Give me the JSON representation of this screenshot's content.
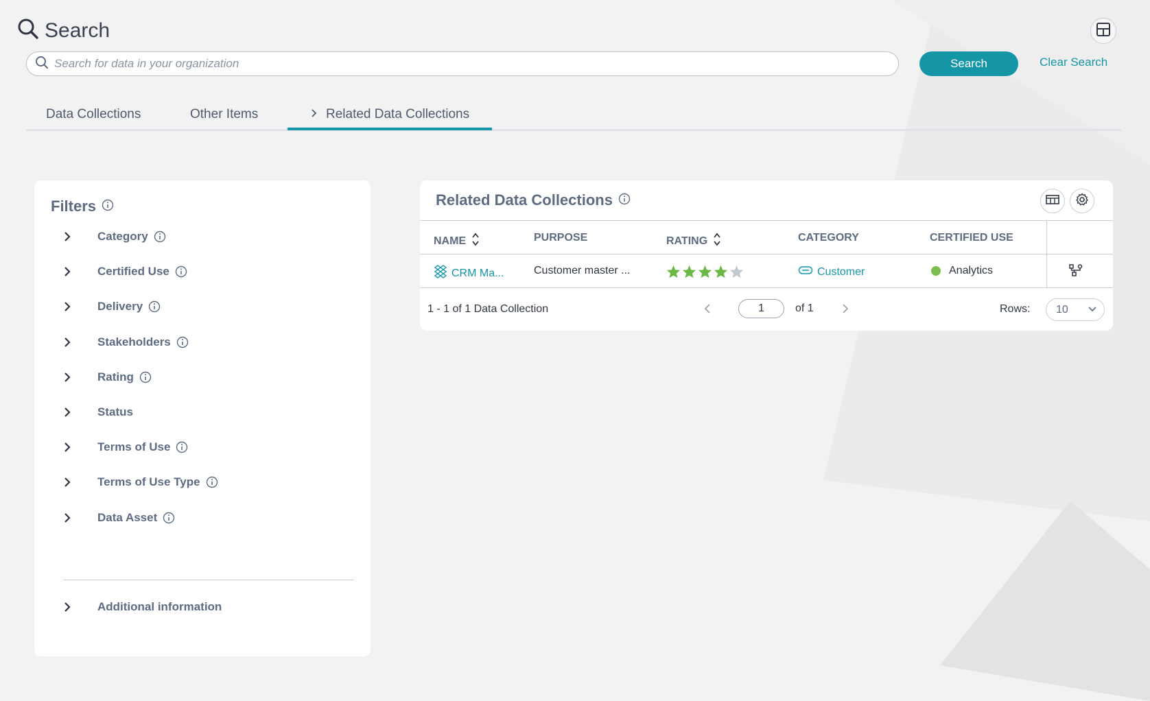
{
  "header": {
    "title": "Search",
    "icon": "search-icon"
  },
  "search": {
    "placeholder": "Search for data in your organization",
    "value": "",
    "button_label": "Search",
    "clear_label": "Clear Search"
  },
  "tabs": [
    {
      "label": "Data Collections",
      "active": false
    },
    {
      "label": "Other Items",
      "active": false
    },
    {
      "label": "Related Data Collections",
      "active": true
    }
  ],
  "filters": {
    "title": "Filters",
    "items": [
      {
        "label": "Category",
        "has_info": true
      },
      {
        "label": "Certified Use",
        "has_info": true
      },
      {
        "label": "Delivery",
        "has_info": true
      },
      {
        "label": "Stakeholders",
        "has_info": true
      },
      {
        "label": "Rating",
        "has_info": true
      },
      {
        "label": "Status",
        "has_info": false
      },
      {
        "label": "Terms of Use",
        "has_info": true
      },
      {
        "label": "Terms of Use Type",
        "has_info": true
      },
      {
        "label": "Data Asset",
        "has_info": true
      }
    ],
    "additional": "Additional information"
  },
  "results": {
    "title": "Related Data Collections",
    "columns": [
      "NAME",
      "PURPOSE",
      "RATING",
      "CATEGORY",
      "CERTIFIED USE"
    ],
    "rows": [
      {
        "name": "CRM Ma...",
        "purpose": "Customer master ...",
        "rating": 4,
        "rating_max": 5,
        "category": "Customer",
        "certified_use": "Analytics"
      }
    ],
    "count_text": "1 - 1 of 1 Data Collection",
    "page": "1",
    "of_text": "of 1",
    "rows_label": "Rows:",
    "rows_value": "10"
  },
  "colors": {
    "accent": "#1596a7",
    "star_filled": "#6cb844",
    "star_empty": "#c2c8cf",
    "status_dot": "#7cbe4f"
  }
}
